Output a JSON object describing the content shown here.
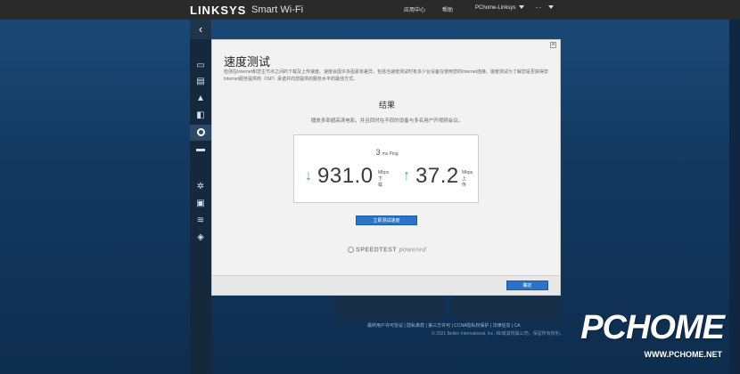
{
  "topbar": {
    "brand": "LINKSYS",
    "product": "Smart Wi-Fi",
    "help_center": "应用中心",
    "help": "帮助",
    "account": "PChome-Linksys",
    "user": "- -"
  },
  "sidebar": {
    "back_icon": "chevron-left-icon",
    "items": [
      {
        "icon": "devices-icon"
      },
      {
        "icon": "map-icon"
      },
      {
        "icon": "alert-icon"
      },
      {
        "icon": "parental-icon"
      },
      {
        "icon": "speedtest-icon",
        "active": true
      },
      {
        "icon": "media-icon"
      },
      {
        "icon": "settings-icon"
      },
      {
        "icon": "security-icon"
      },
      {
        "icon": "wifi-icon"
      },
      {
        "icon": "shield-icon"
      }
    ]
  },
  "modal": {
    "title": "速度测试",
    "description": "检测在Internet和您主节点之间的下载及上传速度。速度会因许多因素有差异，包括当速度测试时有多少台设备在使用您的Internet连接。速度测试为了解您是否获得您Internet服务提供商（ISP）承诺并向您提供的服务水平的最佳方式。",
    "result_heading": "结果",
    "result_sub": "播放多部超高清电影，并且同时在不同的设备与多名用户开视频会议。",
    "ping_value": "3",
    "ping_unit": "ms Ping",
    "download_value": "931.0",
    "download_unit": "Mbps",
    "download_label": "下载",
    "upload_value": "37.2",
    "upload_unit": "Mbps",
    "upload_label": "上传",
    "run_button": "立即测试速度",
    "powered_speedtest": "SPEEDTEST",
    "powered_by": "powered",
    "ok_button": "确定"
  },
  "footer": {
    "links": "最终用户许可协议 | 隐私条款 | 第三方许可 | CCNA隐私权保护 | 法律信息 | CA",
    "copyright": "© 2021 Belkin International, Inc. 和/或其附属公司。保留所有权利。"
  },
  "watermark": {
    "big": "PCHOME",
    "small": "WWW.PCHOME.NET"
  }
}
